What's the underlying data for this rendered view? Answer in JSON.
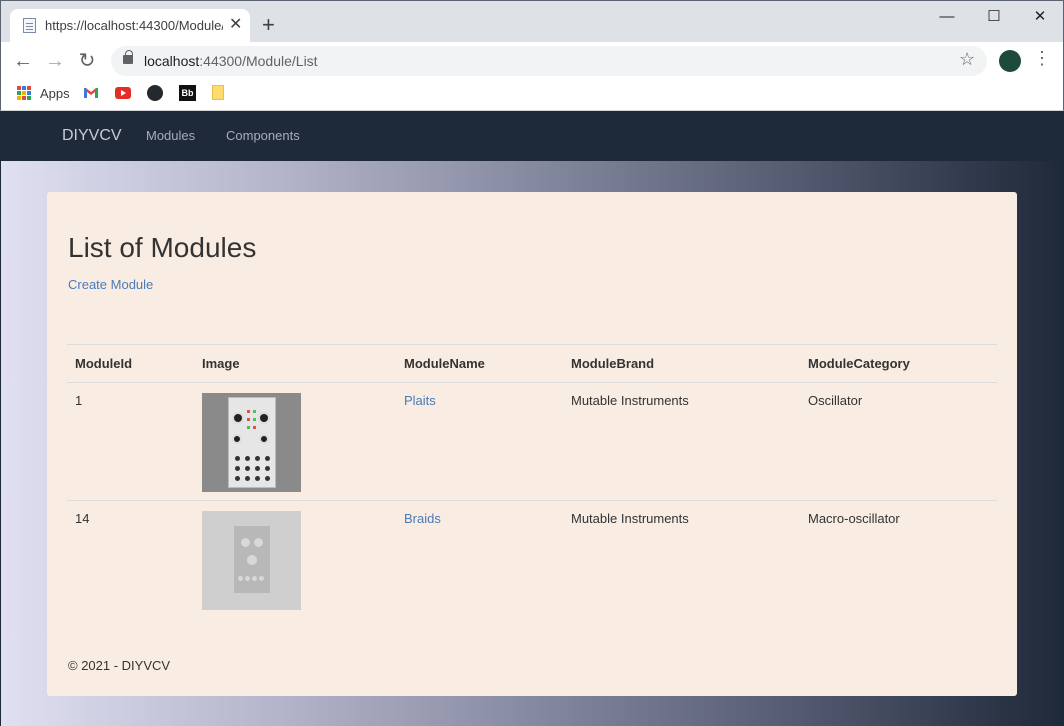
{
  "browser": {
    "tab_title": "https://localhost:44300/Module/List",
    "url_host": "localhost",
    "url_rest": ":44300/Module/List",
    "bookmarks": {
      "apps_label": "Apps",
      "bb_label": "Bb"
    }
  },
  "site": {
    "brand": "DIYVCV",
    "nav": [
      "Modules",
      "Components"
    ]
  },
  "main": {
    "title": "List of Modules",
    "create_link": "Create Module",
    "table": {
      "headers": [
        "ModuleId",
        "Image",
        "ModuleName",
        "ModuleBrand",
        "ModuleCategory"
      ],
      "rows": [
        {
          "id": "1",
          "image": "plaits-module-photo",
          "name": "Plaits",
          "brand": "Mutable Instruments",
          "category": "Oscillator"
        },
        {
          "id": "14",
          "image": "placeholder-module-image",
          "name": "Braids",
          "brand": "Mutable Instruments",
          "category": "Macro-oscillator"
        }
      ]
    }
  },
  "footer": {
    "text": "© 2021 - DIYVCV"
  },
  "colors": {
    "navbar": "#1e2939",
    "card": "#f9ede3",
    "link": "#4a7ab8"
  }
}
